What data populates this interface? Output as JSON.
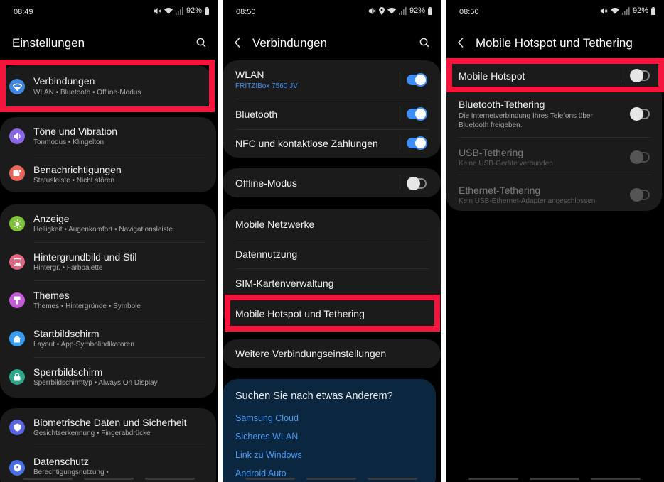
{
  "screen1": {
    "status": {
      "time": "08:49",
      "battery": "92%"
    },
    "title": "Einstellungen",
    "groups": [
      {
        "items": [
          {
            "title": "Verbindungen",
            "subtitle": "WLAN  •  Bluetooth  •  Offline-Modus",
            "icon": "wifi-icon",
            "color": "#3f87e0"
          }
        ]
      },
      {
        "items": [
          {
            "title": "Töne und Vibration",
            "subtitle": "Tonmodus  •  Klingelton",
            "icon": "speaker-icon",
            "color": "#8b67e6"
          },
          {
            "title": "Benachrichtigungen",
            "subtitle": "Statusleiste  •  Nicht stören",
            "icon": "notification-icon",
            "color": "#e8665a"
          }
        ]
      },
      {
        "items": [
          {
            "title": "Anzeige",
            "subtitle": "Helligkeit  •  Augenkomfort  •  Navigationsleiste",
            "icon": "sun-icon",
            "color": "#7fc13a"
          },
          {
            "title": "Hintergrundbild und Stil",
            "subtitle": "Hintergr.  •  Farbpalette",
            "icon": "image-icon",
            "color": "#e0647e"
          },
          {
            "title": "Themes",
            "subtitle": "Themes  •  Hintergründe  •  Symbole",
            "icon": "brush-icon",
            "color": "#c45bd6"
          },
          {
            "title": "Startbildschirm",
            "subtitle": "Layout  •  App-Symbolindikatoren",
            "icon": "home-icon",
            "color": "#3a9cf0"
          },
          {
            "title": "Sperrbildschirm",
            "subtitle": "Sperrbildschirmtyp  •  Always On Display",
            "icon": "lock-icon",
            "color": "#2fa68a"
          }
        ]
      },
      {
        "items": [
          {
            "title": "Biometrische Daten und Sicherheit",
            "subtitle": "Gesichtserkennung  •  Fingerabdrücke",
            "icon": "shield-icon",
            "color": "#5a63e0"
          },
          {
            "title": "Datenschutz",
            "subtitle": "Berechtigungsnutzung  •",
            "icon": "privacy-icon",
            "color": "#4a6fe0"
          }
        ]
      }
    ]
  },
  "screen2": {
    "status": {
      "time": "08:50",
      "battery": "92%"
    },
    "title": "Verbindungen",
    "wlan": {
      "title": "WLAN",
      "subtitle": "FRITZ!Box 7560 JV",
      "on": true
    },
    "bluetooth": {
      "title": "Bluetooth",
      "on": true
    },
    "nfc": {
      "title": "NFC und kontaktlose Zahlungen",
      "on": true
    },
    "offline": {
      "title": "Offline-Modus",
      "on": false
    },
    "menu": [
      "Mobile Netzwerke",
      "Datennutzung",
      "SIM-Kartenverwaltung",
      "Mobile Hotspot und Tethering"
    ],
    "more": "Weitere Verbindungseinstellungen",
    "suggest": {
      "question": "Suchen Sie nach etwas Anderem?",
      "links": [
        "Samsung Cloud",
        "Sicheres WLAN",
        "Link zu Windows",
        "Android Auto"
      ]
    }
  },
  "screen3": {
    "status": {
      "time": "08:50",
      "battery": "92%"
    },
    "title": "Mobile Hotspot und Tethering",
    "items": [
      {
        "title": "Mobile Hotspot",
        "subtitle": "",
        "state": "off"
      },
      {
        "title": "Bluetooth-Tethering",
        "subtitle": "Die Internetverbindung Ihres Telefons über Bluetooth freigeben.",
        "state": "off"
      },
      {
        "title": "USB-Tethering",
        "subtitle": "Keine USB-Geräte verbunden",
        "state": "disabled"
      },
      {
        "title": "Ethernet-Tethering",
        "subtitle": "Kein USB-Ethernet-Adapter angeschlossen",
        "state": "disabled"
      }
    ]
  },
  "colors": {
    "highlight": "#f5143b",
    "toggle_on": "#3e8ef7",
    "link": "#4c9cf8",
    "card": "#1b1b1b"
  }
}
